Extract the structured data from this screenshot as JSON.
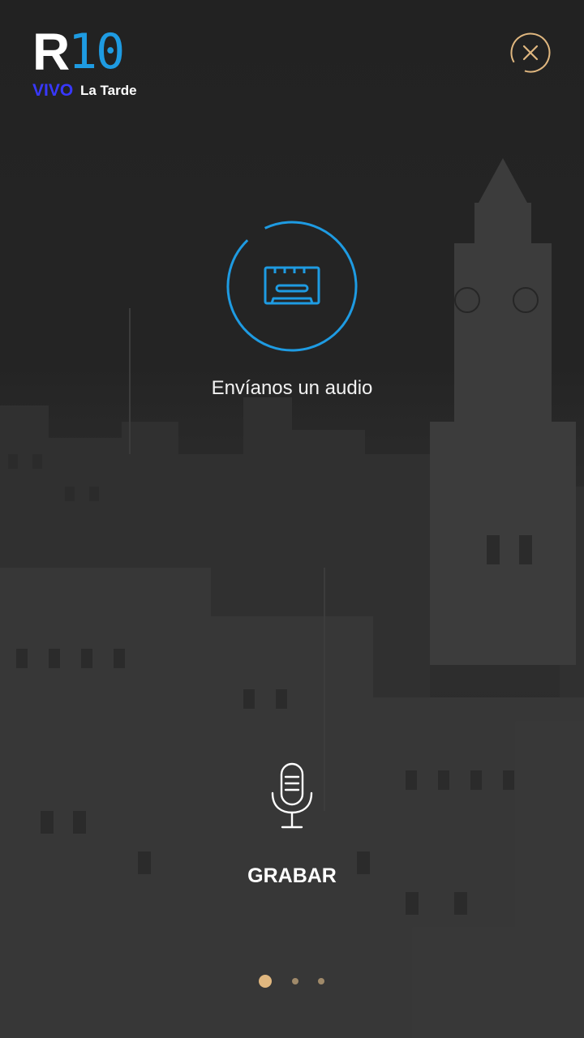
{
  "header": {
    "logo_letter": "R",
    "logo_number": "10",
    "live_label": "VIVO",
    "program_name": "La Tarde"
  },
  "close_icon": "close-icon",
  "main": {
    "feature_icon": "cassette-icon",
    "feature_label": "Envíanos un audio"
  },
  "record": {
    "icon": "microphone-icon",
    "label": "GRABAR"
  },
  "pagination": {
    "total": 3,
    "active": 1
  },
  "colors": {
    "accent_blue": "#1e9be2",
    "live_blue": "#3838ff",
    "gold": "#e0b77f"
  }
}
